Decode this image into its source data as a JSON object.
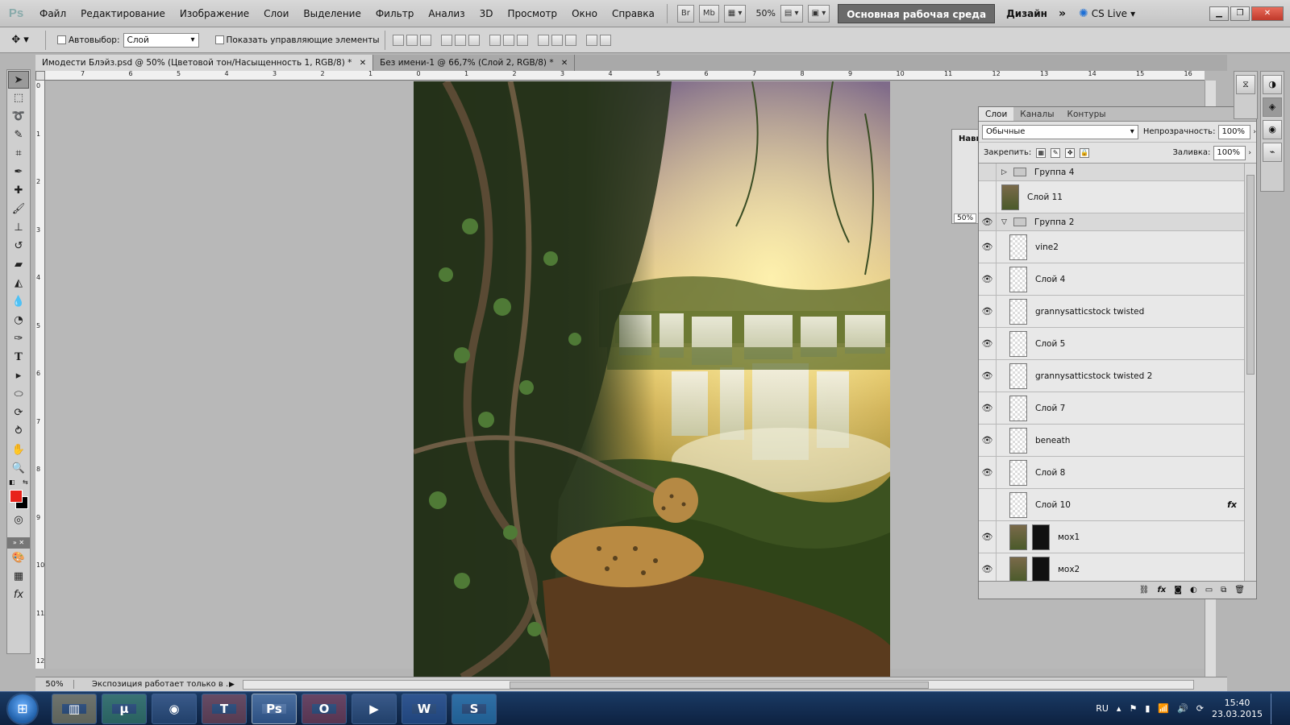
{
  "app": {
    "logo": "Ps"
  },
  "menu": [
    "Файл",
    "Редактирование",
    "Изображение",
    "Слои",
    "Выделение",
    "Фильтр",
    "Анализ",
    "3D",
    "Просмотр",
    "Окно",
    "Справка"
  ],
  "menubar": {
    "bridge": "Br",
    "minibridge": "Mb",
    "zoom": "50%",
    "workspace_main": "Основная рабочая среда",
    "workspace_design": "Дизайн",
    "more": "»",
    "cslive": "CS Live"
  },
  "options": {
    "autoselect_label": "Автовыбор:",
    "autoselect_value": "Слой",
    "show_controls_label": "Показать управляющие элементы"
  },
  "tabs": [
    {
      "label": "Имодести Блэйз.psd @ 50% (Цветовой тон/Насыщенность 1, RGB/8) *",
      "close": "✕"
    },
    {
      "label": "Без имени-1 @ 66,7% (Слой 2, RGB/8) *",
      "close": "✕"
    }
  ],
  "ruler_h": [
    "7",
    "6",
    "5",
    "4",
    "3",
    "2",
    "1",
    "0",
    "1",
    "2",
    "3",
    "4",
    "5",
    "6",
    "7",
    "8",
    "9",
    "10",
    "11",
    "12",
    "13",
    "14",
    "15",
    "16"
  ],
  "ruler_v": [
    "0",
    "1",
    "2",
    "3",
    "4",
    "5",
    "6",
    "7",
    "8",
    "9",
    "10",
    "11",
    "12"
  ],
  "navigator": {
    "label": "Нави",
    "zoom": "50%"
  },
  "layers_panel": {
    "tabs": [
      "Слои",
      "Каналы",
      "Контуры"
    ],
    "blend_mode": "Обычные",
    "opacity_label": "Непрозрачность:",
    "opacity": "100%",
    "lock_label": "Закрепить:",
    "fill_label": "Заливка:",
    "fill": "100%",
    "layers": [
      {
        "name": "Группа 4",
        "type": "group",
        "visible": false,
        "expanded": false
      },
      {
        "name": "Слой 11",
        "type": "layer",
        "visible": false,
        "thumb": "img"
      },
      {
        "name": "Группа 2",
        "type": "group",
        "visible": true,
        "expanded": true
      },
      {
        "name": "vine2",
        "type": "layer",
        "visible": true
      },
      {
        "name": "Слой 4",
        "type": "layer",
        "visible": true
      },
      {
        "name": "grannysatticstock twisted",
        "type": "layer",
        "visible": true
      },
      {
        "name": "Слой 5",
        "type": "layer",
        "visible": true
      },
      {
        "name": "grannysatticstock twisted 2",
        "type": "layer",
        "visible": true
      },
      {
        "name": "Слой 7",
        "type": "layer",
        "visible": true
      },
      {
        "name": "beneath",
        "type": "layer",
        "visible": true
      },
      {
        "name": "Слой 8",
        "type": "layer",
        "visible": true
      },
      {
        "name": "Слой 10",
        "type": "layer",
        "visible": false,
        "fx": "fx"
      },
      {
        "name": "мох1",
        "type": "layer",
        "visible": true,
        "thumb": "img",
        "mask": true
      },
      {
        "name": "мох2",
        "type": "layer",
        "visible": true,
        "thumb": "img",
        "mask": true
      }
    ]
  },
  "status": {
    "zoom": "50%",
    "info": "Экспозиция работает только в ..."
  },
  "taskbar": {
    "apps": [
      "▥",
      "μ",
      "◉",
      "T",
      "Ps",
      "O",
      "▶",
      "W",
      "S"
    ],
    "lang": "RU",
    "time": "15:40",
    "date": "23.03.2015"
  },
  "colors": {
    "foreground": "#e8231a",
    "background": "#000000"
  }
}
